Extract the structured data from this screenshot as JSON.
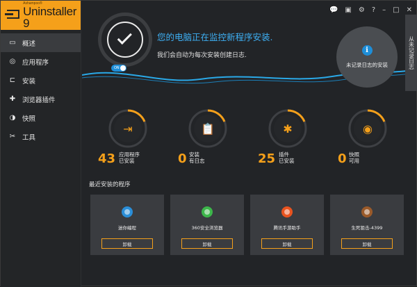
{
  "app": {
    "brand": "Ashampoo®",
    "name": "Uninstaller 9"
  },
  "titlebar": [
    "💬",
    "▣",
    "⚙",
    "?",
    "–",
    "□",
    "✕"
  ],
  "sidebar": {
    "items": [
      {
        "label": "概述",
        "icon": "monitor-icon",
        "glyph": "▭",
        "active": true
      },
      {
        "label": "应用程序",
        "icon": "apps-icon",
        "glyph": "◎",
        "active": false
      },
      {
        "label": "安装",
        "icon": "install-icon",
        "glyph": "⊏",
        "active": false
      },
      {
        "label": "浏览器插件",
        "icon": "puzzle-icon",
        "glyph": "✚",
        "active": false
      },
      {
        "label": "快照",
        "icon": "snapshot-icon",
        "glyph": "◑",
        "active": false
      },
      {
        "label": "工具",
        "icon": "tools-icon",
        "glyph": "✂",
        "active": false
      }
    ]
  },
  "hero": {
    "title": "您的电脑正在监控新程序安装.",
    "subtitle": "我们会自动为每次安装创建日志.",
    "toggle": "ON",
    "log_label": "未记录日志的安装",
    "side_tab": "从未记录日志"
  },
  "stats": [
    {
      "value": "43",
      "label1": "应用程序",
      "label2": "已安装",
      "icon": "install-screen-icon",
      "glyph": "⇥"
    },
    {
      "value": "0",
      "label1": "安装",
      "label2": "有日志",
      "icon": "clipboard-icon",
      "glyph": "📋"
    },
    {
      "value": "25",
      "label1": "插件",
      "label2": "已安装",
      "icon": "puzzle-icon",
      "glyph": "✱"
    },
    {
      "value": "0",
      "label1": "快照",
      "label2": "可用",
      "icon": "snapshot-icon",
      "glyph": "◉"
    }
  ],
  "recent": {
    "title": "最近安装的程序",
    "cards": [
      {
        "name": "迷你编程",
        "button": "卸载",
        "icon": "mini-programming-icon",
        "color": "#2a8ed8"
      },
      {
        "name": "360安全浏览器",
        "button": "卸载",
        "icon": "browser-360-icon",
        "color": "#3cb64a"
      },
      {
        "name": "腾讯手游助手",
        "button": "卸载",
        "icon": "tencent-game-icon",
        "color": "#e8531f"
      },
      {
        "name": "生死狙击-4399",
        "button": "卸载",
        "icon": "game-avatar-icon",
        "color": "#9a5a2a"
      }
    ]
  },
  "colors": {
    "accent": "#f5a01a",
    "blue": "#3eb0f5"
  }
}
